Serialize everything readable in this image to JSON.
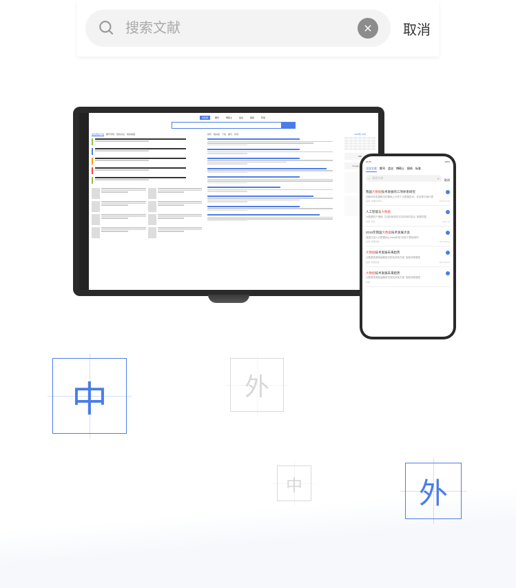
{
  "search": {
    "placeholder": "搜索文献",
    "cancel": "取消"
  },
  "desktop": {
    "tabs": [
      "中知网",
      "期刊",
      "博硕士",
      "会议",
      "报纸",
      "年鉴"
    ],
    "search_btn": "检索",
    "left_tabs": [
      "最近阅读下载",
      "期刊专辑",
      "我的关注",
      "我的收藏"
    ],
    "items_colors": [
      "#8bc34a",
      "#4a7de8",
      "#ff9800",
      "#f44336"
    ],
    "center_tabs": [
      "排序",
      "相关度",
      "下载",
      "被引",
      "时间"
    ],
    "calendar_header": "2018年 12月",
    "logo_aip": "AIP",
    "logo_google": "Google 学术搜索"
  },
  "mobile": {
    "time": "16:25",
    "battery": "100%",
    "tabs": [
      "全部文献",
      "期刊",
      "会议",
      "博硕士",
      "报纸",
      "标准"
    ],
    "search_placeholder": "搜索文献",
    "cancel": "取消",
    "results": [
      {
        "title_parts": [
          "我国",
          "大数据",
          "技术发展的三项体系研究"
        ],
        "hl_idx": 1,
        "body": "创新体系发展概况的基础上分析了大数据技术、安全等方面代表",
        "meta1": "来源: 中国科学院",
        "meta2": "2018-04-30"
      },
      {
        "title_parts": [
          "人工智能",
          "与",
          "大数据"
        ],
        "hl_idx": 2,
        "body": "大数据的产涌使, 生成的秘密形式实际效的复杂, 数据挖掘",
        "meta1": "来源: 清华",
        "meta2": "2017-12"
      },
      {
        "title_parts": [
          "2018年我国",
          "大数据",
          "技术发展大会"
        ],
        "hl_idx": 1,
        "body": "我国已进入大数据(Big data)阶段?如何下载使用的",
        "meta1": "来源: 海南智慧",
        "meta2": "2017-09-21"
      },
      {
        "title_parts": [
          "大数据",
          "技术发展未来趋势"
        ],
        "hl_idx": 0,
        "body": "大数据资源保留著家法规及其他方案, 智能领域课堂",
        "meta1": "来源: 海南智慧",
        "meta2": "2017-06-21"
      },
      {
        "title_parts": [
          "大数据",
          "技术发展未来趋势"
        ],
        "hl_idx": 0,
        "body": "大数据资源保留著家法规及其他方案, 智能领域课堂",
        "meta1": "来源",
        "meta2": ""
      }
    ]
  },
  "tiles": {
    "t1": "中",
    "t2": "外",
    "t3": "中",
    "t4": "外"
  }
}
